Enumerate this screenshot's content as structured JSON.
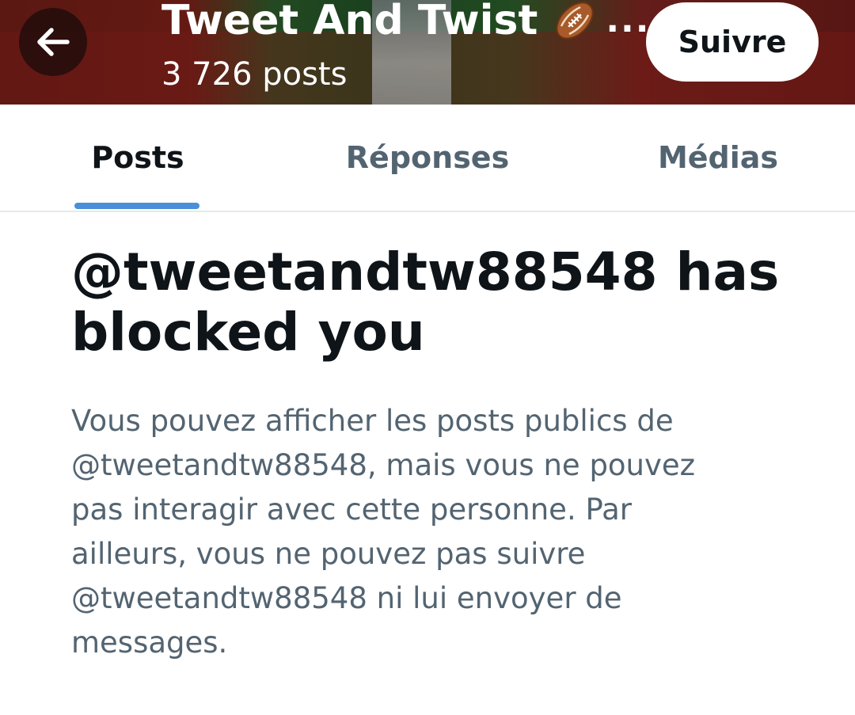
{
  "header": {
    "name": "Tweet And Twist",
    "name_emoji": "rugby-ball-icon",
    "ellipsis": "...",
    "post_count": "3 726 posts",
    "follow_label": "Suivre",
    "back_icon": "arrow-left-icon"
  },
  "tabs": [
    {
      "label": "Posts",
      "active": true
    },
    {
      "label": "Réponses",
      "active": false
    },
    {
      "label": "Médias",
      "active": false
    }
  ],
  "blocked": {
    "title": "@tweetandtw88548 has blocked you",
    "description": "Vous pouvez afficher les posts publics de @tweetandtw88548, mais vous ne pouvez pas interagir avec cette personne. Par ailleurs, vous ne pouvez pas suivre @tweetandtw88548 ni lui envoyer de messages."
  },
  "colors": {
    "accent": "#4a90d9",
    "text_primary": "#0f1419",
    "text_secondary": "#536471"
  }
}
